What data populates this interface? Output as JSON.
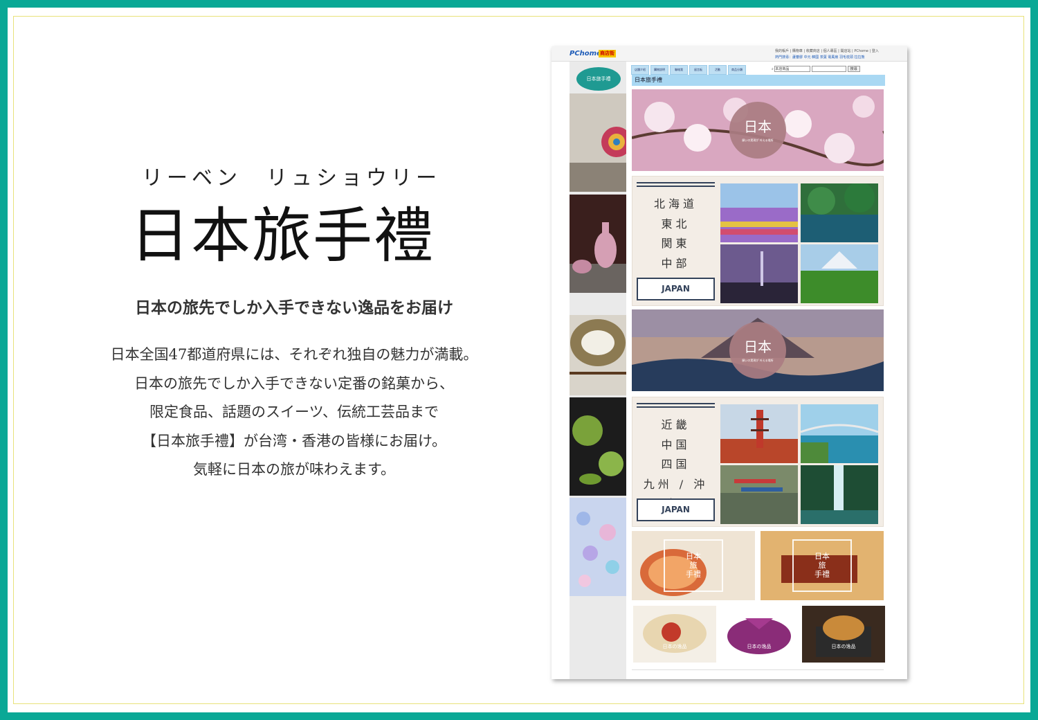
{
  "colors": {
    "frame": "#0aa896",
    "inner_line": "#e8e27a",
    "accent_blue": "#a9d8f3",
    "navy": "#33425a",
    "circle": "#aa7d82"
  },
  "intro": {
    "ruby": "リーベン　リュショウリー",
    "title": "日本旅手禮",
    "subtitle": "日本の旅先でしか入手できない逸品をお届け",
    "lines": [
      "日本全国47都道府県には、それぞれ独自の魅力が満載。",
      "日本の旅先でしか入手できない定番の銘菓から、",
      "限定食品、話題のスイーツ、伝統工芸品まで",
      "【日本旅手禮】が台湾・香港の皆様にお届け。",
      "気軽に日本の旅が味わえます。"
    ]
  },
  "shot": {
    "logo": "PChome",
    "badge": "商店街",
    "top_links": "我的帳戶 | 購物車 | 收藏商店 | 個人專區 | 開店站 | PChome | 登入",
    "top_links2": "熱門搜尋：蘆薈膠 中元 韓國 茶葉 電風扇 羽毛枕頭 拉拉熊",
    "store_logo": "日本旅手禮",
    "nav_tabs": [
      "店舗介紹",
      "購物說明",
      "聯絡我",
      "留言板",
      "活動",
      "商品分類"
    ],
    "search": {
      "select": "本店商品",
      "button": "搜尋"
    },
    "store_title": "日本旅手禮",
    "banner1": {
      "title": "日本",
      "sub": "願いの実現が 叶える場所"
    },
    "banner2": {
      "title": "日本",
      "sub": "願いの実現が 叶える場所"
    },
    "region1": {
      "names": [
        "北海道",
        "東北",
        "関東",
        "中部"
      ],
      "button": "JAPAN"
    },
    "region2": {
      "names": [
        "近畿",
        "中国",
        "四国",
        "九州 / 沖縄"
      ],
      "button": "JAPAN"
    },
    "products": [
      {
        "label": "日本\n旅\n手禮"
      },
      {
        "label": "日本\n旅\n手禮"
      }
    ],
    "bottom_tiles": [
      "日本の逸品",
      "日本の逸品",
      "日本の逸品"
    ]
  }
}
